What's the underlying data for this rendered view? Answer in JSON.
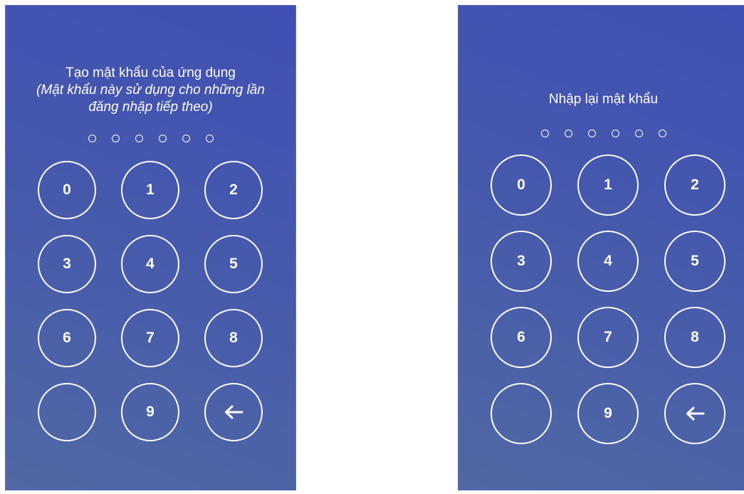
{
  "create_screen": {
    "title_line1": "Tạo mật khẩu của ứng dụng",
    "title_line2": "(Mật khẩu này sử dụng cho những lần",
    "title_line3": "đăng nhập tiếp theo)",
    "pin_length": 6,
    "keys": [
      "0",
      "1",
      "2",
      "3",
      "4",
      "5",
      "6",
      "7",
      "8",
      "",
      "9",
      "backspace-icon"
    ]
  },
  "confirm_screen": {
    "title": "Nhập lại mật khẩu",
    "pin_length": 6,
    "keys": [
      "0",
      "1",
      "2",
      "3",
      "4",
      "5",
      "6",
      "7",
      "8",
      "",
      "9",
      "backspace-icon"
    ]
  },
  "colors": {
    "background_top": "#3f4fb4",
    "background_bottom": "#5068a4",
    "foreground": "#ffffff"
  }
}
